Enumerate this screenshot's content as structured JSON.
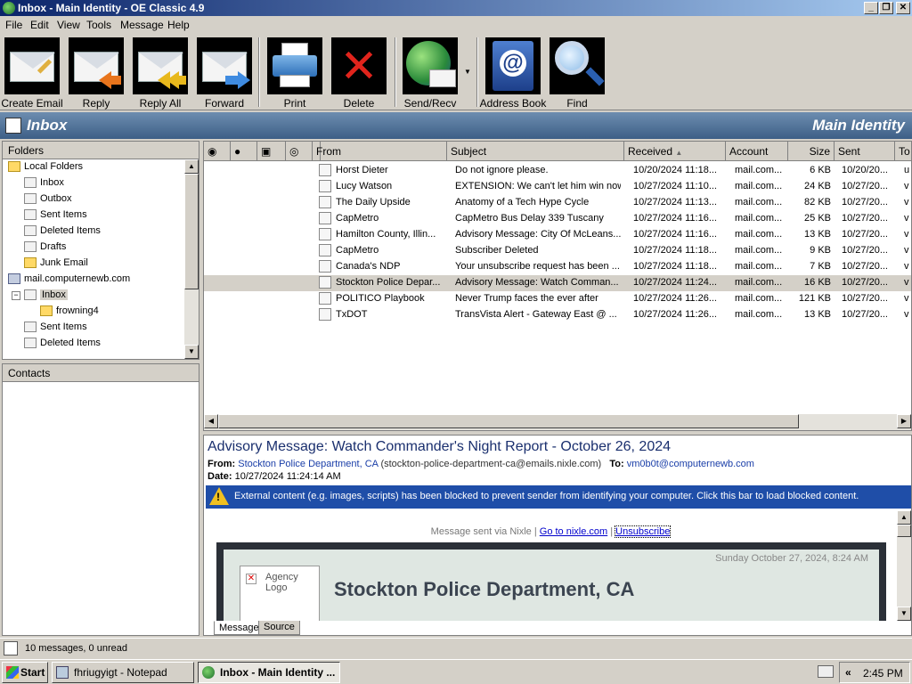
{
  "window": {
    "title": "Inbox - Main Identity - OE Classic 4.9"
  },
  "menu": [
    "File",
    "Edit",
    "View",
    "Tools",
    "Message",
    "Help"
  ],
  "toolbar": {
    "create_email": "Create Email",
    "reply": "Reply",
    "reply_all": "Reply All",
    "forward": "Forward",
    "print": "Print",
    "delete": "Delete",
    "send_recv": "Send/Recv",
    "address_book": "Address Book",
    "find": "Find"
  },
  "header": {
    "folder": "Inbox",
    "identity": "Main Identity"
  },
  "folders": {
    "title": "Folders",
    "items": [
      "Local Folders",
      "Inbox",
      "Outbox",
      "Sent Items",
      "Deleted Items",
      "Drafts",
      "Junk Email",
      "mail.computernewb.com",
      "Inbox",
      "frowning4",
      "Sent Items",
      "Deleted Items"
    ]
  },
  "contacts": {
    "title": "Contacts"
  },
  "message_list": {
    "columns": [
      "From",
      "Subject",
      "Received",
      "Account",
      "Size",
      "Sent",
      "To"
    ],
    "rows": [
      {
        "from": "Horst Dieter",
        "subject": "Do not ignore please.",
        "received": "10/20/2024 11:18...",
        "account": "mail.com...",
        "size": "6 KB",
        "sent": "10/20/20...",
        "to": "u"
      },
      {
        "from": "Lucy Watson",
        "subject": "EXTENSION: We can't let him win now...",
        "received": "10/27/2024 11:10...",
        "account": "mail.com...",
        "size": "24 KB",
        "sent": "10/27/20...",
        "to": "v"
      },
      {
        "from": "The Daily Upside",
        "subject": "Anatomy of a Tech Hype Cycle",
        "received": "10/27/2024 11:13...",
        "account": "mail.com...",
        "size": "82 KB",
        "sent": "10/27/20...",
        "to": "v"
      },
      {
        "from": "CapMetro",
        "subject": "CapMetro Bus Delay 339 Tuscany",
        "received": "10/27/2024 11:16...",
        "account": "mail.com...",
        "size": "25 KB",
        "sent": "10/27/20...",
        "to": "v"
      },
      {
        "from": "Hamilton County, Illin...",
        "subject": "Advisory Message: City Of McLeans...",
        "received": "10/27/2024 11:16...",
        "account": "mail.com...",
        "size": "13 KB",
        "sent": "10/27/20...",
        "to": "v"
      },
      {
        "from": "CapMetro",
        "subject": "Subscriber Deleted",
        "received": "10/27/2024 11:18...",
        "account": "mail.com...",
        "size": "9 KB",
        "sent": "10/27/20...",
        "to": "v"
      },
      {
        "from": "Canada's NDP",
        "subject": "Your unsubscribe request has been ...",
        "received": "10/27/2024 11:18...",
        "account": "mail.com...",
        "size": "7 KB",
        "sent": "10/27/20...",
        "to": "v"
      },
      {
        "from": "Stockton Police Depar...",
        "subject": "Advisory Message: Watch Comman...",
        "received": "10/27/2024 11:24...",
        "account": "mail.com...",
        "size": "16 KB",
        "sent": "10/27/20...",
        "to": "v"
      },
      {
        "from": "POLITICO Playbook",
        "subject": "Never Trump faces the ever after",
        "received": "10/27/2024 11:26...",
        "account": "mail.com...",
        "size": "121 KB",
        "sent": "10/27/20...",
        "to": "v"
      },
      {
        "from": "TxDOT",
        "subject": "TransVista Alert - Gateway East @ ...",
        "received": "10/27/2024 11:26...",
        "account": "mail.com...",
        "size": "13 KB",
        "sent": "10/27/20...",
        "to": "v"
      }
    ]
  },
  "preview": {
    "subject": "Advisory Message: Watch Commander's Night Report - October 26, 2024",
    "from_label": "From:",
    "from_name": "Stockton Police Department, CA",
    "from_email": "(stockton-police-department-ca@emails.nixle.com)",
    "to_label": "To:",
    "to_value": "vm0b0t@computernewb.com",
    "date_label": "Date:",
    "date_value": "10/27/2024 11:24:14 AM",
    "blocked_notice": "External content (e.g. images, scripts) has been blocked to prevent sender from identifying your computer. Click this bar to load blocked content.",
    "sent_via": "Message sent via Nixle |",
    "goto_link": "Go to nixle.com",
    "pipe": "|",
    "unsubscribe": "Unsubscribe",
    "email_date": "Sunday October 27, 2024, 8:24 AM",
    "agency_logo": "Agency Logo",
    "department": "Stockton Police Department, CA"
  },
  "tabs": [
    "Message",
    "Source"
  ],
  "status": {
    "text": "10 messages, 0 unread"
  },
  "taskbar": {
    "start": "Start",
    "tasks": [
      "fhriugyigt - Notepad",
      "Inbox - Main Identity ..."
    ],
    "clock": "2:45 PM",
    "chevron": "«"
  }
}
